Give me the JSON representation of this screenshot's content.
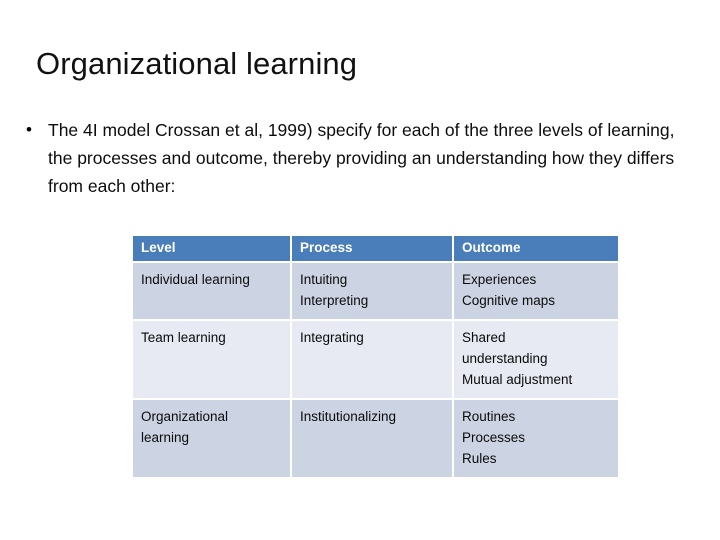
{
  "slide": {
    "title": "Organizational learning",
    "bullet_marker": "•",
    "bullet_text": "The 4I model Crossan et al, 1999) specify for each of the three levels of learning, the processes and outcome, thereby providing an understanding how they differs from each other:"
  },
  "colors": {
    "header_fill": "#4A7EBB",
    "header_text": "#FFFFFF",
    "row_shade": "#CCD3E3",
    "row_light": "#E7EAF3",
    "body_text": "#0B0B0B",
    "background": "#FFFFFF"
  },
  "table": {
    "columns": [
      "Level",
      "Process",
      "Outcome"
    ],
    "rows": [
      {
        "level": [
          "Individual learning"
        ],
        "process": [
          "Intuiting",
          "Interpreting"
        ],
        "outcome": [
          "Experiences",
          "Cognitive maps"
        ]
      },
      {
        "level": [
          "Team learning"
        ],
        "process": [
          "Integrating"
        ],
        "outcome": [
          "Shared",
          "understanding",
          "Mutual adjustment"
        ]
      },
      {
        "level": [
          "Organizational",
          "learning"
        ],
        "process": [
          "Institutionalizing"
        ],
        "outcome": [
          "Routines",
          "Processes",
          "Rules"
        ]
      }
    ]
  }
}
